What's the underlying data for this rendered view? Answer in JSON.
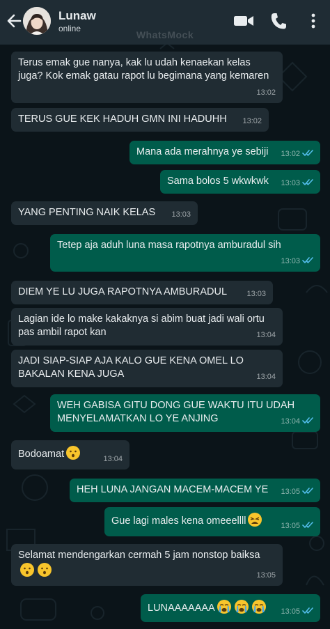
{
  "header": {
    "contact_name": "Lunaw",
    "status": "online"
  },
  "watermark": "WhatsMock",
  "messages": [
    {
      "direction": "in",
      "text": "Terus emak gue nanya, kak lu udah kenaekan kelas juga? Kok emak gatau rapot lu begimana yang kemaren",
      "time": "13:02"
    },
    {
      "direction": "in",
      "text": "TERUS GUE KEK HADUH GMN INI HADUHH",
      "time": "13:02"
    },
    {
      "direction": "out",
      "text": "Mana ada merahnya ye sebiji",
      "time": "13:02",
      "status": "read"
    },
    {
      "direction": "out",
      "text": "Sama bolos 5 wkwkwk",
      "time": "13:03",
      "status": "read"
    },
    {
      "direction": "in",
      "text": "YANG PENTING NAIK KELAS",
      "time": "13:03"
    },
    {
      "direction": "out",
      "text": "Tetep aja aduh luna masa rapotnya amburadul sih",
      "time": "13:03",
      "status": "read"
    },
    {
      "direction": "in",
      "text": "DIEM YE LU JUGA RAPOTNYA AMBURADUL",
      "time": "13:03"
    },
    {
      "direction": "in",
      "text": "Lagian ide lo make kakaknya si abim buat jadi wali ortu pas ambil rapot kan",
      "time": "13:04"
    },
    {
      "direction": "in",
      "text": "JADI SIAP-SIAP AJA KALO GUE KENA OMEL LO BAKALAN KENA JUGA",
      "time": "13:04"
    },
    {
      "direction": "out",
      "text": "WEH GABISA GITU DONG GUE WAKTU ITU UDAH MENYELAMATKAN LO YE ANJING",
      "time": "13:04",
      "status": "read"
    },
    {
      "direction": "in",
      "text": "Bodoamat",
      "time": "13:04",
      "emojis": [
        "hushed-face-emoji"
      ]
    },
    {
      "direction": "out",
      "text": "HEH LUNA JANGAN MACEM-MACEM YE",
      "time": "13:05",
      "status": "read"
    },
    {
      "direction": "out",
      "text": "Gue lagi males kena omeeellll",
      "time": "13:05",
      "status": "read",
      "emojis": [
        "tired-face-emoji"
      ]
    },
    {
      "direction": "in",
      "text": "Selamat mendengarkan cermah 5 jam nonstop baiksa",
      "time": "13:05",
      "emojis": [
        "hushed-face-emoji",
        "hushed-face-emoji"
      ]
    },
    {
      "direction": "out",
      "text": "LUNAAAAAAA",
      "time": "13:05",
      "status": "read",
      "emojis": [
        "crying-face-emoji",
        "crying-face-emoji",
        "crying-face-emoji"
      ]
    }
  ],
  "colors": {
    "header_bg": "#1f2c34",
    "chat_bg": "#0b1419",
    "incoming_bubble": "#202c33",
    "outgoing_bubble": "#005c4b",
    "read_ticks": "#53bdeb"
  },
  "icons": {
    "back": "arrow-left-icon",
    "video": "video-camera-icon",
    "call": "phone-icon",
    "menu": "more-vertical-icon"
  }
}
